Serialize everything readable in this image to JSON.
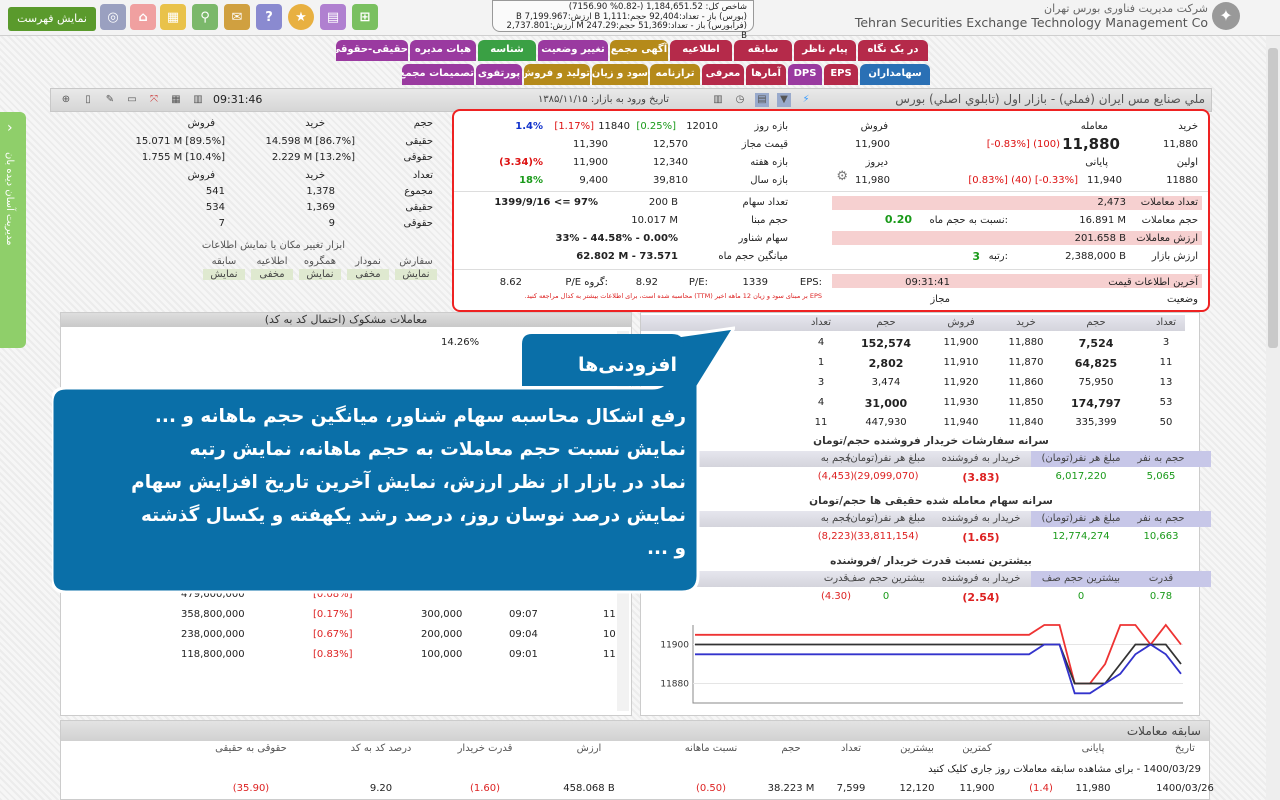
{
  "topbar": {
    "show_list": "نمایش فهرست",
    "icons": [
      "map-icon",
      "globe-icon",
      "home-icon",
      "calculator-icon",
      "search-icon",
      "chat-icon",
      "help-icon",
      "new-icon",
      "monitor-icon",
      "grid-icon"
    ],
    "market_lines": [
      "شاخص کل: 1,184,651.52 (-0.82% 7156.90)",
      "(بورس) باز - تعداد:92,404 حجم:1,111 B ارزش:7,199.967 B",
      "(فرابورس) باز - تعداد:51,369 حجم:247.29 M ارزش:2,737.801 B"
    ],
    "brand_fa": "شرکت مدیریت فناوری بورس تهران",
    "brand_en": "Tehran Securities Exchange Technology Management Co"
  },
  "tabs_row1": [
    {
      "label": "در یک نگاه",
      "color": "#b52a4a"
    },
    {
      "label": "پیام ناظر",
      "color": "#b52a4a"
    },
    {
      "label": "سابقه",
      "color": "#b52a4a"
    },
    {
      "label": "اطلاعیه",
      "color": "#b52a4a"
    },
    {
      "label": "آگهی مجمع",
      "color": "#b58a1a"
    },
    {
      "label": "تغییر وضعیت",
      "color": "#9a3aa0"
    },
    {
      "label": "شناسه",
      "color": "#3aa044"
    },
    {
      "label": "هیات مدیره",
      "color": "#9a3aa0"
    },
    {
      "label": "حقیقی-حقوقی",
      "color": "#9a3aa0"
    }
  ],
  "tabs_row2": [
    {
      "label": "سهامداران",
      "color": "#2a70b5"
    },
    {
      "label": "EPS",
      "color": "#b52a4a"
    },
    {
      "label": "DPS",
      "color": "#9a3aa0"
    },
    {
      "label": "آمارها",
      "color": "#b52a4a"
    },
    {
      "label": "معرفی",
      "color": "#b52a4a"
    },
    {
      "label": "ترازنامه",
      "color": "#b58a1a"
    },
    {
      "label": "سود و زیان",
      "color": "#b58a1a"
    },
    {
      "label": "تولید و فروش",
      "color": "#b58a1a"
    },
    {
      "label": "پورتفوی",
      "color": "#9a3aa0"
    },
    {
      "label": "تصمیمات مجمع",
      "color": "#9a3aa0"
    }
  ],
  "titlebar": {
    "symbol": "ملي صنايع مس ايران (فملي) - بازار اول (تابلوي اصلي) بورس",
    "entry": "تاریخ ورود به بازار: ۱۳۸۵/۱۱/۱۵",
    "time": "09:31:46"
  },
  "sidepanel": {
    "label": "مدیریت آسان دیده بان"
  },
  "buyer_table": {
    "headers": [
      "حجم",
      "خرید",
      "فروش"
    ],
    "rows": [
      {
        "label": "حقیقی",
        "buy": "14.598 M [86.7%]",
        "sell": "15.071 M [89.5%]"
      },
      {
        "label": "حقوقی",
        "buy": "2.229 M [13.2%]",
        "sell": "1.755 M [10.4%]"
      }
    ],
    "count_headers": [
      "تعداد",
      "خرید",
      "فروش"
    ],
    "count_rows": [
      {
        "label": "مجموع",
        "buy": "1,378",
        "sell": "541"
      },
      {
        "label": "حقیقی",
        "buy": "1,369",
        "sell": "534"
      },
      {
        "label": "حقوقی",
        "buy": "9",
        "sell": "7"
      }
    ],
    "tools_title": "ابزار تغییر مکان یا نمایش اطلاعات",
    "tools": [
      {
        "l1": "سفارش",
        "l2": "نمایش"
      },
      {
        "l1": "نمودار",
        "l2": "مخفی"
      },
      {
        "l1": "همگروه",
        "l2": "نمایش"
      },
      {
        "l1": "اطلاعیه",
        "l2": "مخفی"
      },
      {
        "l1": "سابقه",
        "l2": "نمایش"
      }
    ]
  },
  "info": {
    "buy": "خرید",
    "trade": "معامله",
    "sell": "فروش",
    "buy_price": "11,880",
    "trade_price": "11,880",
    "trade_change": "[-0.83%]  (100)",
    "sell_price": "11,900",
    "first": "اولین",
    "last": "پایانی",
    "yesterday": "دیروز",
    "first_price": "11880",
    "last_price": "11,940",
    "last_change": "[0.83%]  (40)  [-0.33%]",
    "yest_price": "11,980",
    "day_range": "بازه روز",
    "allowed": "قیمت مجاز",
    "week_range": "بازه هفته",
    "year_range": "بازه سال",
    "day_lo": "12010",
    "day_lo_pct": "[0.25%]",
    "day_hi": "11840",
    "day_hi_pct": "[1.17%]",
    "day_pct": "1.4%",
    "allow_lo": "12,570",
    "allow_hi": "11,390",
    "week_lo": "12,340",
    "week_hi": "11,900",
    "week_pct": "(3.34)%",
    "year_lo": "39,810",
    "year_hi": "9,400",
    "year_pct": "18%",
    "shares_label": "تعداد سهام",
    "shares": "200 B",
    "base_label": "حجم مبنا",
    "base": "10.017 M",
    "float_label": "سهام شناور",
    "float": "33% - 44.58% - 0.00%",
    "avg_label": "میانگین حجم ماه",
    "avg": "62.802 M - 73.571",
    "growth": "1399/9/16 <= 97%",
    "n_trades_label": "تعداد معاملات",
    "n_trades": "2,473",
    "vol_label": "حجم معاملات",
    "vol": "16.891 M",
    "vol_ratio_label": "نسبت به حجم ماه:",
    "vol_ratio": "0.20",
    "val_label": "ارزش معاملات",
    "val": "201.658 B",
    "mkt_label": "ارزش بازار",
    "mkt": "2,388,000 B",
    "rank_label": "رتبه:",
    "rank": "3",
    "eps_label": "EPS:",
    "eps": "1339",
    "pe_label": "P/E:",
    "pe": "8.92",
    "gpe_label": "P/E گروه:",
    "gpe": "8.62",
    "note": "EPS بر مبنای سود و زیان 12 ماهه اخیر (TTM) محاسبه شده است، برای اطلاعات بیشتر به کدال مراجعه کنید.",
    "last_info_label": "آخرین اطلاعات قیمت",
    "last_info": "09:31:41",
    "status_label": "وضعیت",
    "status": "مجاز"
  },
  "trades": {
    "title": "معاملات مشکوک (احتمال کد به کد)",
    "first_row_pct": "14.26%",
    "rows": [
      {
        "v": "479,600,000",
        "p": "[0.08%]",
        "q": "",
        "t": "",
        "n": ""
      },
      {
        "v": "358,800,000",
        "p": "[0.17%]",
        "q": "300,000",
        "t": "09:07",
        "n": "11"
      },
      {
        "v": "238,000,000",
        "p": "[0.67%]",
        "q": "200,000",
        "t": "09:04",
        "n": "10"
      },
      {
        "v": "118,800,000",
        "p": "[0.83%]",
        "q": "100,000",
        "t": "09:01",
        "n": "11"
      }
    ]
  },
  "orderbook": {
    "headers": [
      "تعداد",
      "حجم",
      "خرید",
      "فروش",
      "حجم",
      "تعداد"
    ],
    "rows": [
      [
        "3",
        "7,524",
        "11,880",
        "11,900",
        "152,574",
        "4"
      ],
      [
        "11",
        "64,825",
        "11,870",
        "11,910",
        "2,802",
        "1"
      ],
      [
        "13",
        "75,950",
        "11,860",
        "11,920",
        "3,474",
        "3"
      ],
      [
        "53",
        "174,797",
        "11,850",
        "11,930",
        "31,000",
        "4"
      ],
      [
        "50",
        "335,399",
        "11,840",
        "11,940",
        "447,930",
        "11"
      ]
    ]
  },
  "buyer_power": {
    "title": "سرانه سفارشات خریدار فروشنده حجم/تومان",
    "headers": [
      "حجم به نفر",
      "مبلغ هر نفر(تومان)",
      "خریدار به فروشنده",
      "مبلغ هر نفر(تومان)",
      "حجم به"
    ],
    "values": [
      "5,065",
      "6,017,220",
      "(3.83)",
      "(29,099,070)",
      "(4,453)"
    ]
  },
  "real_per": {
    "title": "سرانه سهام معامله شده حقیقی ها حجم/تومان",
    "headers": [
      "حجم به نفر",
      "مبلغ هر نفر(تومان)",
      "خریدار به فروشنده",
      "مبلغ هر نفر(تومان)",
      "حجم به"
    ],
    "values": [
      "10,663",
      "12,774,274",
      "(1.65)",
      "(33,811,154)",
      "(8,223)"
    ]
  },
  "max_power": {
    "title": "بیشترین نسبت قدرت خریدار /فروشنده",
    "headers": [
      "قدرت",
      "بیشترین حجم صف",
      "خریدار به فروشنده",
      "بیشترین حجم صف",
      "قدرت"
    ],
    "values": [
      "0.78",
      "0",
      "(2.54)",
      "0",
      "(4.30)"
    ]
  },
  "chart_data": {
    "type": "line",
    "y_ticks": [
      "11900",
      "11880"
    ],
    "ylim": [
      11870,
      11910
    ],
    "series": [
      {
        "color": "#e33",
        "values": [
          11905,
          11905,
          11905,
          11905,
          11905,
          11905,
          11905,
          11905,
          11905,
          11905,
          11905,
          11905,
          11905,
          11905,
          11905,
          11905,
          11905,
          11905,
          11905,
          11905,
          11905,
          11905,
          11905,
          11910,
          11910,
          11880,
          11880,
          11890,
          11910,
          11910,
          11900,
          11910,
          11900
        ]
      },
      {
        "color": "#333",
        "values": [
          11900,
          11900,
          11900,
          11900,
          11900,
          11900,
          11900,
          11900,
          11900,
          11900,
          11900,
          11900,
          11900,
          11900,
          11900,
          11900,
          11900,
          11900,
          11900,
          11900,
          11900,
          11900,
          11900,
          11900,
          11900,
          11880,
          11880,
          11880,
          11890,
          11900,
          11900,
          11900,
          11890
        ]
      },
      {
        "color": "#33c",
        "values": [
          11895,
          11895,
          11895,
          11895,
          11895,
          11895,
          11895,
          11895,
          11895,
          11895,
          11895,
          11895,
          11895,
          11895,
          11895,
          11895,
          11895,
          11895,
          11895,
          11895,
          11895,
          11895,
          11895,
          11900,
          11900,
          11875,
          11875,
          11880,
          11885,
          11895,
          11900,
          11895,
          11885
        ]
      }
    ]
  },
  "history": {
    "title": "سابقه معاملات",
    "headers": [
      "تاریخ",
      "پایانی",
      "",
      "کمترین",
      "بیشترین",
      "تعداد",
      "حجم",
      "نسبت ماهانه",
      "ارزش",
      "قدرت خریدار",
      "درصد کد به کد",
      "حقوقی به حقیقی"
    ],
    "note": "1400/03/29 - برای مشاهده سابقه معاملات روز جاری کلیک کنید",
    "row": [
      "1400/03/26",
      "11,980",
      "(1.4)",
      "11,900",
      "12,120",
      "7,599",
      "38.223 M",
      "(0.50)",
      "458.068 B",
      "(1.60)",
      "9.20",
      "(35.90)"
    ]
  },
  "callout": {
    "title": "افزودنی‌ها",
    "lines": [
      "رفع اشکال محاسبه سهام شناور، میانگین حجم ماهانه و ...",
      "نمایش نسبت حجم معاملات به حجم ماهانه، نمایش رتبه",
      "نماد در بازار از نظر ارزش، نمایش آخرین تاریخ افزایش سهام",
      "نمایش درصد نوسان روز، درصد رشد یکهفته و یکسال گذشته",
      "و ..."
    ],
    "color": "#0a6fa8"
  }
}
